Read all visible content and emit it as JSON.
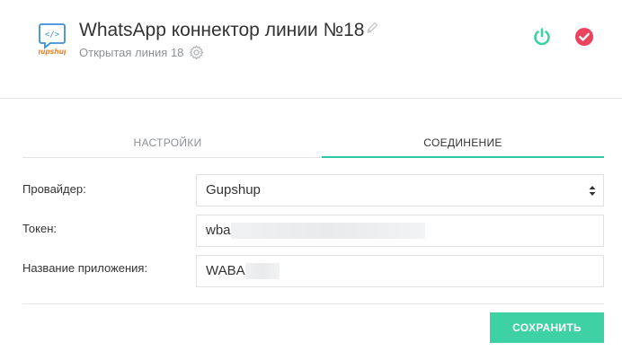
{
  "header": {
    "title": "WhatsApp коннектор линии №18",
    "subtitle": "Открытая линия 18",
    "logo_text": "gupshup",
    "icons": {
      "edit": "pencil-icon",
      "settings": "gear-icon",
      "power": "power-icon",
      "confirm": "check-circle-icon"
    },
    "colors": {
      "power": "#3dd1a4",
      "confirm": "#e9435e"
    }
  },
  "tabs": [
    {
      "label": "НАСТРОЙКИ",
      "active": false
    },
    {
      "label": "СОЕДИНЕНИЕ",
      "active": true
    }
  ],
  "form": {
    "provider": {
      "label": "Провайдер:",
      "value": "Gupshup"
    },
    "token": {
      "label": "Токен:",
      "value": "wba"
    },
    "app_name": {
      "label": "Название приложения:",
      "value": "WABA"
    }
  },
  "actions": {
    "save_label": "СОХРАНИТЬ",
    "save_color": "#3dd1a4"
  }
}
